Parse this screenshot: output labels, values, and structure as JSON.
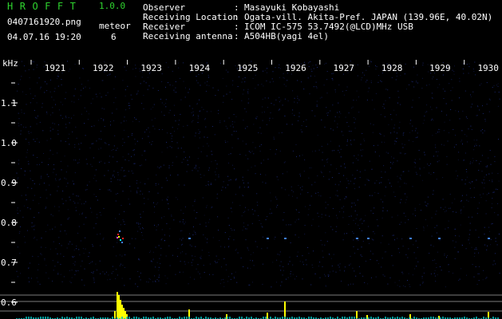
{
  "header": {
    "app_name": "HROFFT",
    "version": "1.0.0",
    "filename": "0407161920.png",
    "datetime": "04.07.16 19:20",
    "meteor_label": "meteor",
    "meteor_count": "6"
  },
  "info": [
    {
      "key": "Observer",
      "value": "Masayuki Kobayashi"
    },
    {
      "key": "Receiving Location",
      "value": "Ogata-vill. Akita-Pref. JAPAN (139.96E, 40.02N)"
    },
    {
      "key": "Receiver",
      "value": "ICOM IC-575 53.7492(@LCD)MHz USB"
    },
    {
      "key": "Receiving antenna",
      "value": "A504HB(yagi 4el)"
    }
  ],
  "spectrogram": {
    "unit": "kHz",
    "x_ticks": [
      "1921",
      "1922",
      "1923",
      "1924",
      "1925",
      "1926",
      "1927",
      "1928",
      "1929",
      "1930"
    ],
    "y_ticks": [
      "1.1",
      "1.0",
      "0.9",
      "0.8",
      "0.7",
      "0.6"
    ],
    "noise_color": "#1c2a7a",
    "signal_color": "#ffff00"
  }
}
